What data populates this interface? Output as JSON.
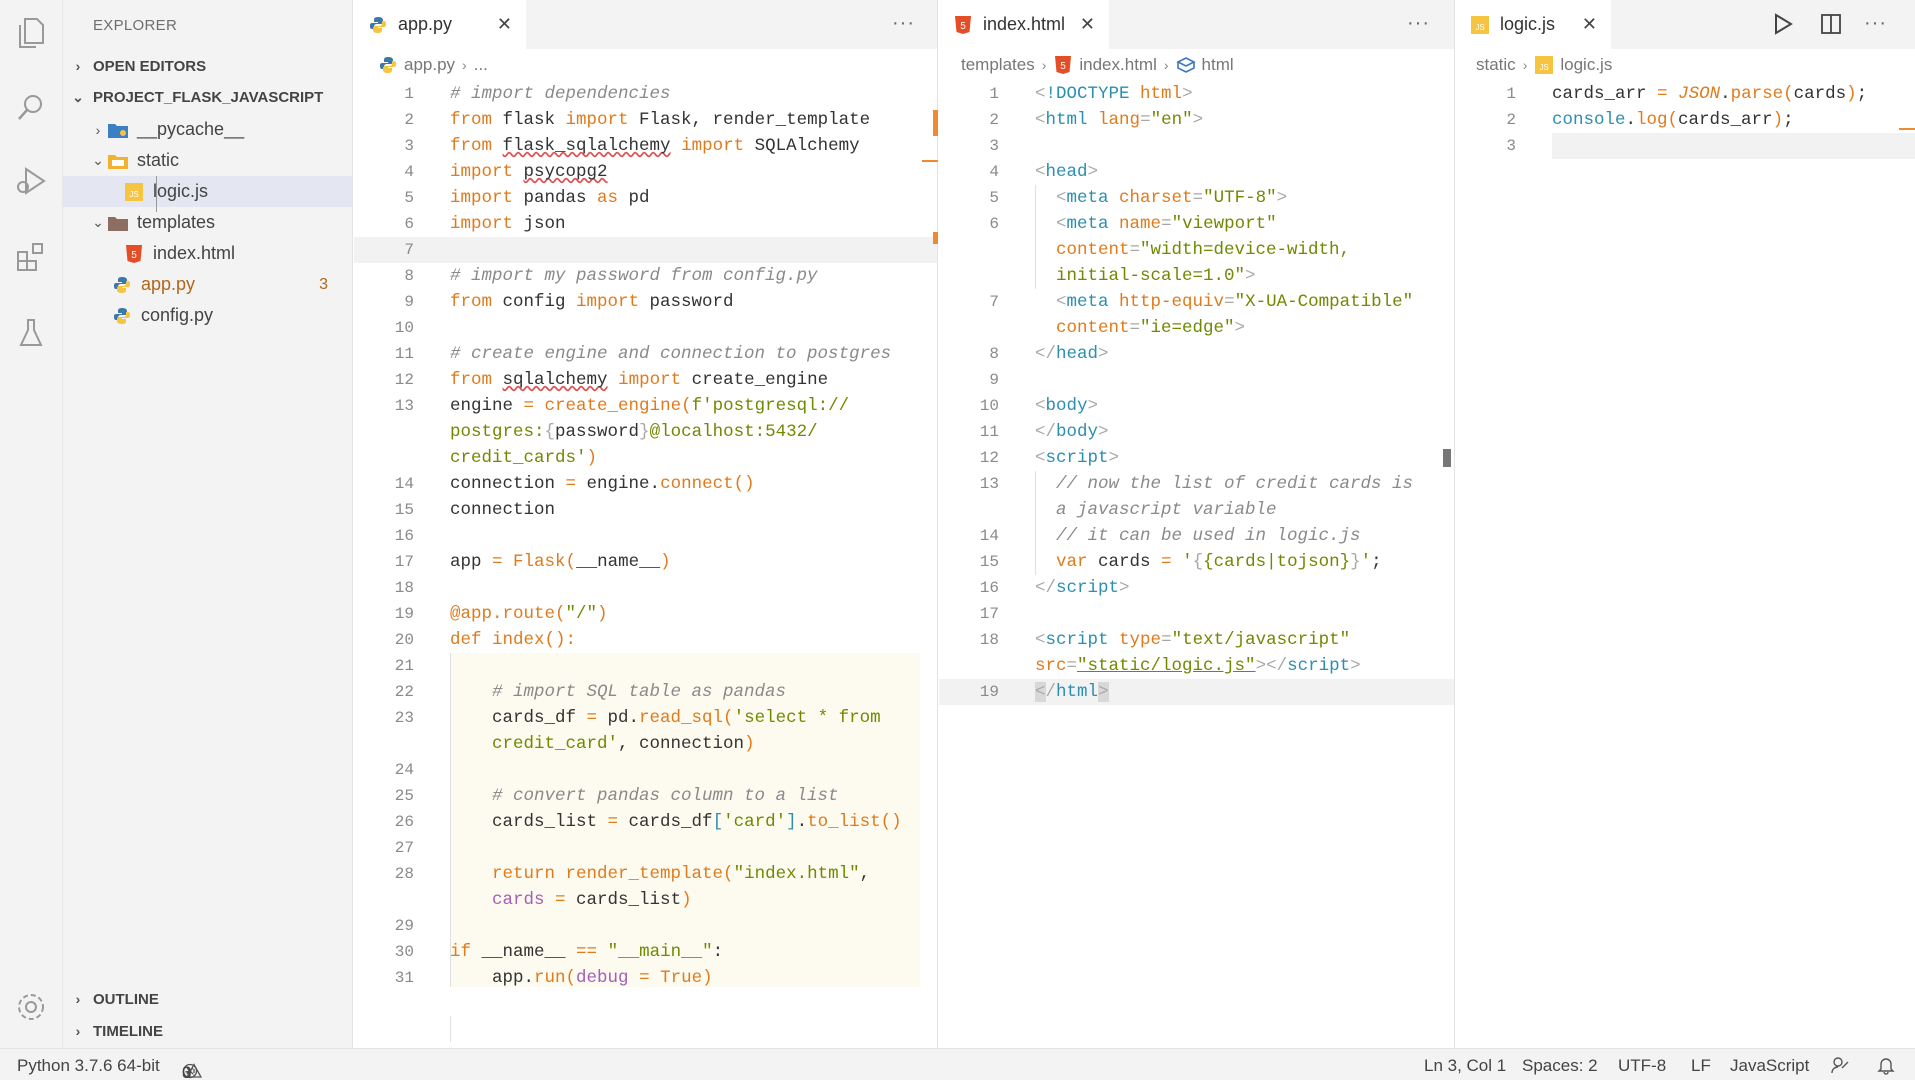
{
  "sidebar": {
    "title": "EXPLORER",
    "sections": {
      "open_editors": "OPEN EDITORS",
      "project": "PROJECT_FLASK_JAVASCRIPT",
      "outline": "OUTLINE",
      "timeline": "TIMELINE"
    },
    "tree": [
      {
        "label": "__pycache__",
        "icon": "folder-icon"
      },
      {
        "label": "static",
        "icon": "folder-icon"
      },
      {
        "label": "logic.js",
        "icon": "javascript-file-icon"
      },
      {
        "label": "templates",
        "icon": "folder-icon"
      },
      {
        "label": "index.html",
        "icon": "html-file-icon"
      },
      {
        "label": "app.py",
        "icon": "python-file-icon",
        "badge": "3"
      },
      {
        "label": "config.py",
        "icon": "python-file-icon"
      }
    ]
  },
  "editors": {
    "app": {
      "tab": "app.py",
      "breadcrumb": {
        "file": "app.py",
        "rest": "..."
      }
    },
    "index": {
      "tab": "index.html",
      "breadcrumb": {
        "folder": "templates",
        "file": "index.html",
        "symbol": "html"
      }
    },
    "logic": {
      "tab": "logic.js",
      "breadcrumb": {
        "folder": "static",
        "file": "logic.js"
      }
    }
  },
  "status": {
    "python": "Python 3.7.6 64-bit",
    "errors": "0",
    "warnings": "3",
    "cursor": "Ln 3, Col 1",
    "spaces": "Spaces: 2",
    "encoding": "UTF-8",
    "eol": "LF",
    "language": "JavaScript"
  },
  "colors": {
    "accent": "#e07b1c",
    "keyword": "#e07b1c",
    "string": "#6f8a00",
    "comment": "#8a8a8a",
    "tag": "#2b8fb0"
  }
}
